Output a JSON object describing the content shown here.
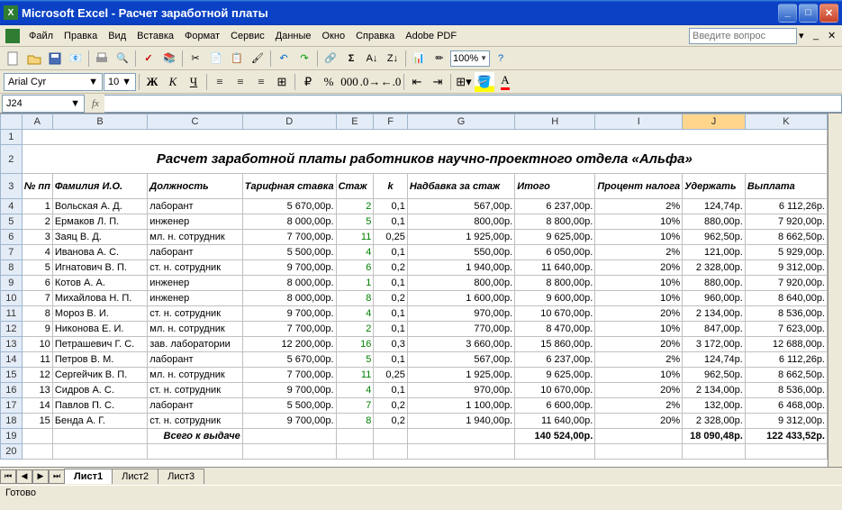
{
  "window": {
    "app": "Microsoft Excel",
    "doc": "Расчет заработной платы"
  },
  "menu": [
    "Файл",
    "Правка",
    "Вид",
    "Вставка",
    "Формат",
    "Сервис",
    "Данные",
    "Окно",
    "Справка",
    "Adobe PDF"
  ],
  "askbox": "Введите вопрос",
  "zoom": "100%",
  "font": {
    "name": "Arial Cyr",
    "size": "10"
  },
  "namebox": "J24",
  "colHeaders": [
    "A",
    "B",
    "C",
    "D",
    "E",
    "F",
    "G",
    "H",
    "I",
    "J",
    "K"
  ],
  "rowHeaders": [
    "1",
    "2",
    "3",
    "4",
    "5",
    "6",
    "7",
    "8",
    "9",
    "10",
    "11",
    "12",
    "13",
    "14",
    "15",
    "16",
    "17",
    "18",
    "19",
    "20"
  ],
  "title": "Расчет заработной платы работников научно-проектного отдела «Альфа»",
  "headers": {
    "num": "№\nпп",
    "name": "Фамилия И.О.",
    "pos": "Должность",
    "rate": "Тарифная\nставка",
    "exp": "Стаж",
    "k": "k",
    "bonus": "Надбавка за стаж",
    "total": "Итого",
    "taxp": "Процент\nналога",
    "hold": "Удержать",
    "pay": "Выплата"
  },
  "rows": [
    {
      "n": "1",
      "name": "Вольская А. Д.",
      "pos": "лаборант",
      "rate": "5 670,00р.",
      "exp": "2",
      "k": "0,1",
      "bonus": "567,00р.",
      "total": "6 237,00р.",
      "taxp": "2%",
      "hold": "124,74р.",
      "pay": "6 112,26р."
    },
    {
      "n": "2",
      "name": "Ермаков Л. П.",
      "pos": "инженер",
      "rate": "8 000,00р.",
      "exp": "5",
      "k": "0,1",
      "bonus": "800,00р.",
      "total": "8 800,00р.",
      "taxp": "10%",
      "hold": "880,00р.",
      "pay": "7 920,00р."
    },
    {
      "n": "3",
      "name": "Заяц В. Д.",
      "pos": "мл. н. сотрудник",
      "rate": "7 700,00р.",
      "exp": "11",
      "k": "0,25",
      "bonus": "1 925,00р.",
      "total": "9 625,00р.",
      "taxp": "10%",
      "hold": "962,50р.",
      "pay": "8 662,50р."
    },
    {
      "n": "4",
      "name": "Иванова А. С.",
      "pos": "лаборант",
      "rate": "5 500,00р.",
      "exp": "4",
      "k": "0,1",
      "bonus": "550,00р.",
      "total": "6 050,00р.",
      "taxp": "2%",
      "hold": "121,00р.",
      "pay": "5 929,00р."
    },
    {
      "n": "5",
      "name": "Игнатович В. П.",
      "pos": "ст. н. сотрудник",
      "rate": "9 700,00р.",
      "exp": "6",
      "k": "0,2",
      "bonus": "1 940,00р.",
      "total": "11 640,00р.",
      "taxp": "20%",
      "hold": "2 328,00р.",
      "pay": "9 312,00р."
    },
    {
      "n": "6",
      "name": "Котов А. А.",
      "pos": "инженер",
      "rate": "8 000,00р.",
      "exp": "1",
      "k": "0,1",
      "bonus": "800,00р.",
      "total": "8 800,00р.",
      "taxp": "10%",
      "hold": "880,00р.",
      "pay": "7 920,00р."
    },
    {
      "n": "7",
      "name": "Михайлова Н. П.",
      "pos": "инженер",
      "rate": "8 000,00р.",
      "exp": "8",
      "k": "0,2",
      "bonus": "1 600,00р.",
      "total": "9 600,00р.",
      "taxp": "10%",
      "hold": "960,00р.",
      "pay": "8 640,00р."
    },
    {
      "n": "8",
      "name": "Мороз В. И.",
      "pos": "ст. н. сотрудник",
      "rate": "9 700,00р.",
      "exp": "4",
      "k": "0,1",
      "bonus": "970,00р.",
      "total": "10 670,00р.",
      "taxp": "20%",
      "hold": "2 134,00р.",
      "pay": "8 536,00р."
    },
    {
      "n": "9",
      "name": "Никонова Е. И.",
      "pos": "мл. н. сотрудник",
      "rate": "7 700,00р.",
      "exp": "2",
      "k": "0,1",
      "bonus": "770,00р.",
      "total": "8 470,00р.",
      "taxp": "10%",
      "hold": "847,00р.",
      "pay": "7 623,00р."
    },
    {
      "n": "10",
      "name": "Петрашевич Г. С.",
      "pos": "зав. лаборатории",
      "rate": "12 200,00р.",
      "exp": "16",
      "k": "0,3",
      "bonus": "3 660,00р.",
      "total": "15 860,00р.",
      "taxp": "20%",
      "hold": "3 172,00р.",
      "pay": "12 688,00р."
    },
    {
      "n": "11",
      "name": "Петров В. М.",
      "pos": "лаборант",
      "rate": "5 670,00р.",
      "exp": "5",
      "k": "0,1",
      "bonus": "567,00р.",
      "total": "6 237,00р.",
      "taxp": "2%",
      "hold": "124,74р.",
      "pay": "6 112,26р."
    },
    {
      "n": "12",
      "name": "Сергейчик В. П.",
      "pos": "мл. н. сотрудник",
      "rate": "7 700,00р.",
      "exp": "11",
      "k": "0,25",
      "bonus": "1 925,00р.",
      "total": "9 625,00р.",
      "taxp": "10%",
      "hold": "962,50р.",
      "pay": "8 662,50р."
    },
    {
      "n": "13",
      "name": "Сидров А. С.",
      "pos": "ст. н. сотрудник",
      "rate": "9 700,00р.",
      "exp": "4",
      "k": "0,1",
      "bonus": "970,00р.",
      "total": "10 670,00р.",
      "taxp": "20%",
      "hold": "2 134,00р.",
      "pay": "8 536,00р."
    },
    {
      "n": "14",
      "name": "Павлов П. С.",
      "pos": "лаборант",
      "rate": "5 500,00р.",
      "exp": "7",
      "k": "0,2",
      "bonus": "1 100,00р.",
      "total": "6 600,00р.",
      "taxp": "2%",
      "hold": "132,00р.",
      "pay": "6 468,00р."
    },
    {
      "n": "15",
      "name": "Бенда А. Г.",
      "pos": "ст. н. сотрудник",
      "rate": "9 700,00р.",
      "exp": "8",
      "k": "0,2",
      "bonus": "1 940,00р.",
      "total": "11 640,00р.",
      "taxp": "20%",
      "hold": "2 328,00р.",
      "pay": "9 312,00р."
    }
  ],
  "totals": {
    "label": "Всего к выдаче",
    "total": "140 524,00р.",
    "hold": "18 090,48р.",
    "pay": "122 433,52р."
  },
  "tabs": [
    "Лист1",
    "Лист2",
    "Лист3"
  ],
  "status": "Готово"
}
